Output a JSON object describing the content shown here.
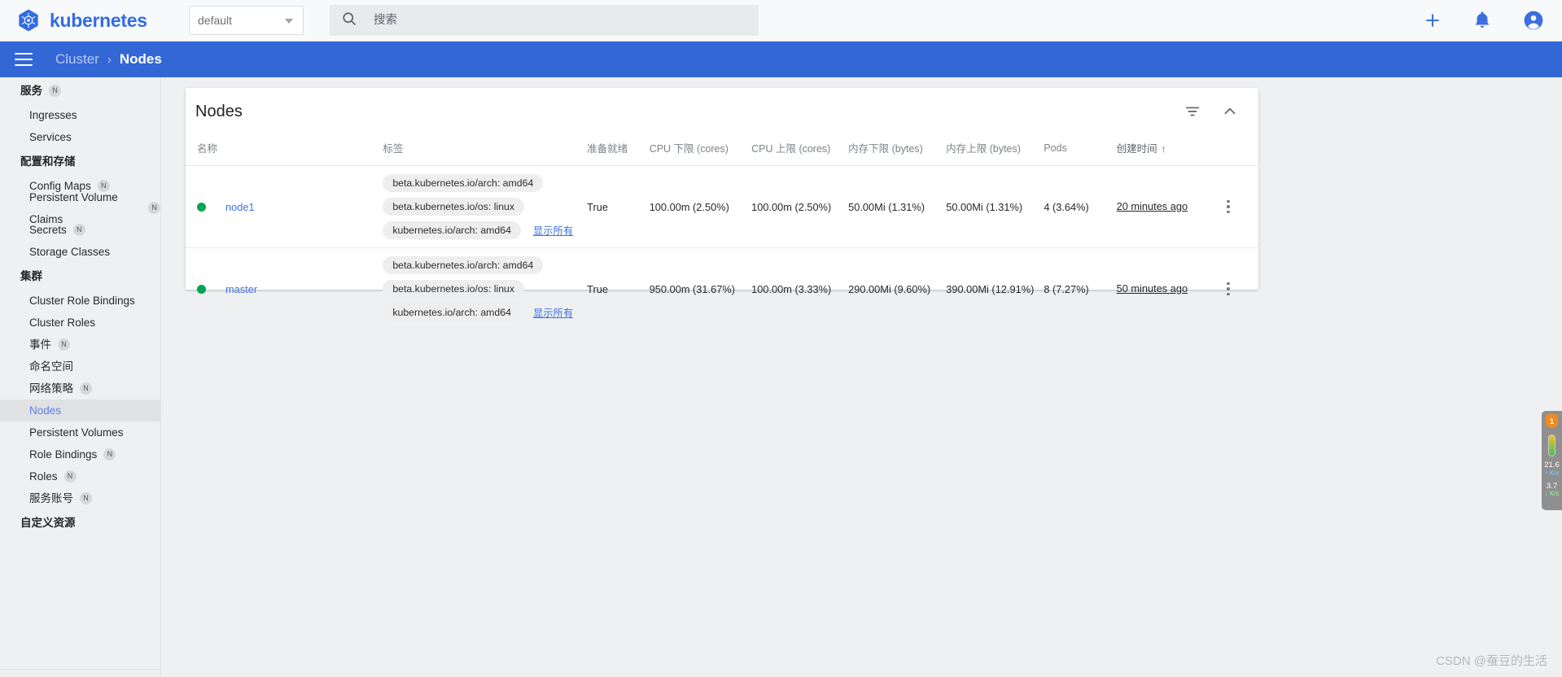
{
  "topbar": {
    "brand": "kubernetes",
    "logo_icon": "kubernetes-helm-logo",
    "namespace_value": "default",
    "namespace_caret_icon": "chevron-down-icon",
    "search_icon": "search-icon",
    "search_placeholder": "搜索",
    "search_value": "",
    "add_icon": "plus-icon",
    "notifications_icon": "bell-icon",
    "account_icon": "account-circle-icon",
    "accent_color": "#326ce5"
  },
  "header": {
    "menu_icon": "hamburger-menu-icon",
    "breadcrumb_parent": "Cluster",
    "breadcrumb_separator": "›",
    "breadcrumb_current": "Nodes",
    "background_color": "#3367d6"
  },
  "sidebar": {
    "sections": [
      {
        "title": "服务",
        "badge": "N",
        "items": [
          {
            "label": "Ingresses",
            "badge": "",
            "active": false
          },
          {
            "label": "Services",
            "badge": "",
            "active": false
          }
        ]
      },
      {
        "title": "配置和存储",
        "badge": "",
        "items": [
          {
            "label": "Config Maps",
            "badge": "N",
            "active": false
          },
          {
            "label": "Persistent Volume Claims",
            "badge": "N",
            "active": false
          },
          {
            "label": "Secrets",
            "badge": "N",
            "active": false
          },
          {
            "label": "Storage Classes",
            "badge": "",
            "active": false
          }
        ]
      },
      {
        "title": "集群",
        "badge": "",
        "items": [
          {
            "label": "Cluster Role Bindings",
            "badge": "",
            "active": false
          },
          {
            "label": "Cluster Roles",
            "badge": "",
            "active": false
          },
          {
            "label": "事件",
            "badge": "N",
            "active": false
          },
          {
            "label": "命名空间",
            "badge": "",
            "active": false
          },
          {
            "label": "网络策略",
            "badge": "N",
            "active": false
          },
          {
            "label": "Nodes",
            "badge": "",
            "active": true
          },
          {
            "label": "Persistent Volumes",
            "badge": "",
            "active": false
          },
          {
            "label": "Role Bindings",
            "badge": "N",
            "active": false
          },
          {
            "label": "Roles",
            "badge": "N",
            "active": false
          },
          {
            "label": "服务账号",
            "badge": "N",
            "active": false
          }
        ]
      },
      {
        "title": "自定义资源",
        "badge": "",
        "items": []
      }
    ]
  },
  "card": {
    "title": "Nodes",
    "filter_icon": "filter-list-icon",
    "collapse_icon": "chevron-up-icon",
    "columns": [
      {
        "key": "name",
        "label": "名称",
        "sorted": false
      },
      {
        "key": "labels",
        "label": "标签",
        "sorted": false
      },
      {
        "key": "ready",
        "label": "准备就绪",
        "sorted": false
      },
      {
        "key": "cpu_req",
        "label": "CPU 下限 (cores)",
        "sorted": false
      },
      {
        "key": "cpu_lim",
        "label": "CPU 上限 (cores)",
        "sorted": false
      },
      {
        "key": "mem_req",
        "label": "内存下限 (bytes)",
        "sorted": false
      },
      {
        "key": "mem_lim",
        "label": "内存上限 (bytes)",
        "sorted": false
      },
      {
        "key": "pods",
        "label": "Pods",
        "sorted": false
      },
      {
        "key": "created",
        "label": "创建时间",
        "sorted": true,
        "sort_arrow": "↑"
      },
      {
        "key": "menu",
        "label": "",
        "sorted": false
      }
    ],
    "show_all_label": "显示所有",
    "status_color": "#00a650",
    "rows": [
      {
        "status_icon": "status-dot-green",
        "name": "node1",
        "labels": [
          "beta.kubernetes.io/arch: amd64",
          "beta.kubernetes.io/os: linux",
          "kubernetes.io/arch: amd64"
        ],
        "ready": "True",
        "cpu_req": "100.00m (2.50%)",
        "cpu_lim": "100.00m (2.50%)",
        "mem_req": "50.00Mi (1.31%)",
        "mem_lim": "50.00Mi (1.31%)",
        "pods": "4 (3.64%)",
        "created": "20 minutes ago",
        "menu_icon": "kebab-menu-icon"
      },
      {
        "status_icon": "status-dot-green",
        "name": "master",
        "labels": [
          "beta.kubernetes.io/arch: amd64",
          "beta.kubernetes.io/os: linux",
          "kubernetes.io/arch: amd64"
        ],
        "ready": "True",
        "cpu_req": "950.00m (31.67%)",
        "cpu_lim": "100.00m (3.33%)",
        "mem_req": "290.00Mi (9.60%)",
        "mem_lim": "390.00Mi (12.91%)",
        "pods": "8 (7.27%)",
        "created": "50 minutes ago",
        "menu_icon": "kebab-menu-icon"
      }
    ]
  },
  "netmeter": {
    "shield_icon": "shield-badge-icon",
    "shield_count": "1",
    "thermometer_icon": "thermometer-icon",
    "upload_value": "21.6",
    "upload_unit": "K/s",
    "download_value": "3.7",
    "download_unit": "K/s"
  },
  "watermark": "CSDN @蚕豆的生活"
}
